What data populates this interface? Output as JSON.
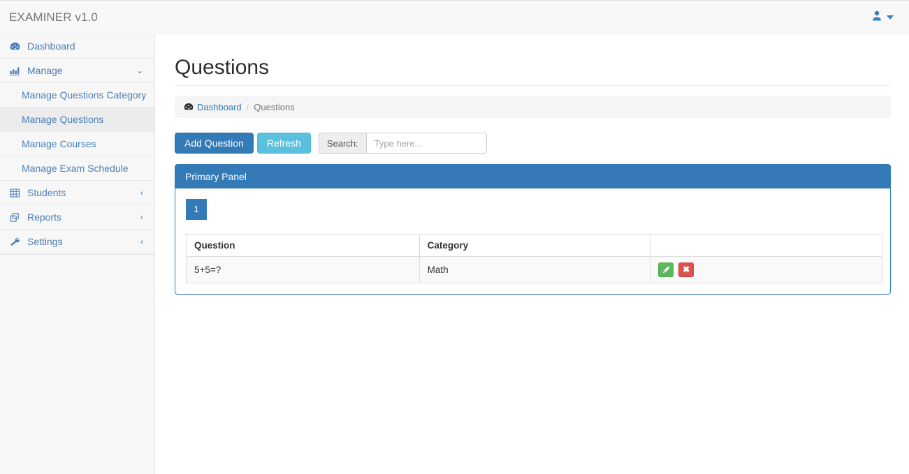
{
  "topbar": {
    "brand": "EXAMINER v1.0",
    "user_icon": "user-icon",
    "caret_icon": "caret-down-icon"
  },
  "sidebar": {
    "items": [
      {
        "label": "Dashboard",
        "icon": "tachometer-icon",
        "chevron": "",
        "active": false
      },
      {
        "label": "Manage",
        "icon": "bar-chart-icon",
        "chevron": "⌄",
        "active": false
      },
      {
        "label": "Students",
        "icon": "table-icon",
        "chevron": "‹",
        "active": false
      },
      {
        "label": "Reports",
        "icon": "files-copy-icon",
        "chevron": "‹",
        "active": false
      },
      {
        "label": "Settings",
        "icon": "wrench-icon",
        "chevron": "‹",
        "active": false
      }
    ],
    "sub_items": [
      {
        "label": "Manage Questions Category",
        "active": false
      },
      {
        "label": "Manage Questions",
        "active": true
      },
      {
        "label": "Manage Courses",
        "active": false
      },
      {
        "label": "Manage Exam Schedule",
        "active": false
      }
    ]
  },
  "main": {
    "page_title": "Questions",
    "breadcrumb": {
      "icon": "tachometer-icon",
      "home": "Dashboard",
      "separator": "/",
      "current": "Questions"
    },
    "toolbar": {
      "add_label": "Add Question",
      "refresh_label": "Refresh",
      "search_label": "Search:",
      "search_value": "",
      "search_placeholder": "Type here..."
    },
    "panel": {
      "heading": "Primary Panel",
      "pagination": [
        "1"
      ],
      "table": {
        "columns": [
          "Question",
          "Category",
          ""
        ],
        "rows": [
          {
            "question": "5+5=?",
            "category": "Math",
            "edit_icon": "pencil-icon",
            "delete_icon": "close-x-icon"
          }
        ]
      }
    }
  },
  "colors": {
    "primary": "#337ab7",
    "info": "#5bc0de",
    "success": "#5cb85c",
    "danger": "#d9534f",
    "link": "#4a7fb5",
    "sidebar_bg": "#f7f7f7",
    "sidebar_active": "#ececec",
    "topbar_bg": "#f8f8f8"
  }
}
